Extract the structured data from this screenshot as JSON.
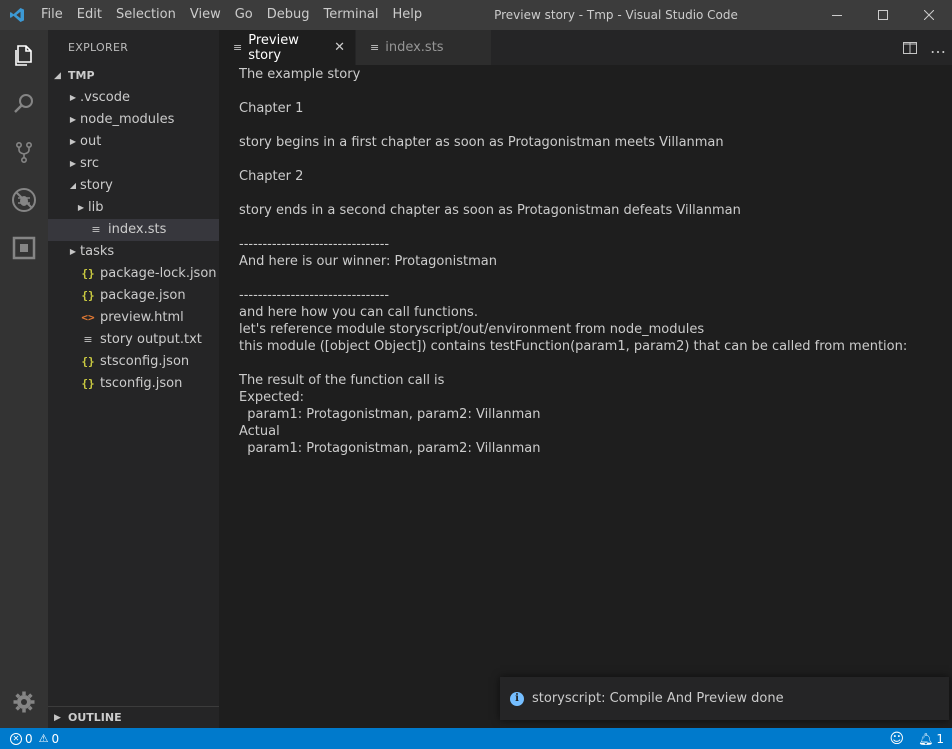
{
  "titlebar": {
    "menu": [
      "File",
      "Edit",
      "Selection",
      "View",
      "Go",
      "Debug",
      "Terminal",
      "Help"
    ],
    "window_title": "Preview story - Tmp - Visual Studio Code"
  },
  "sidebar": {
    "title": "EXPLORER",
    "folder_name": "TMP",
    "items": [
      {
        "label": ".vscode",
        "type": "folder",
        "indent": 1
      },
      {
        "label": "node_modules",
        "type": "folder",
        "indent": 1
      },
      {
        "label": "out",
        "type": "folder",
        "indent": 1
      },
      {
        "label": "src",
        "type": "folder",
        "indent": 1
      },
      {
        "label": "story",
        "type": "folder-open",
        "indent": 1
      },
      {
        "label": "lib",
        "type": "folder",
        "indent": 2
      },
      {
        "label": "index.sts",
        "type": "lines",
        "indent": 2,
        "selected": true
      },
      {
        "label": "tasks",
        "type": "folder",
        "indent": 1
      },
      {
        "label": "package-lock.json",
        "type": "json",
        "indent": 1
      },
      {
        "label": "package.json",
        "type": "json",
        "indent": 1
      },
      {
        "label": "preview.html",
        "type": "html",
        "indent": 1
      },
      {
        "label": "story output.txt",
        "type": "lines",
        "indent": 1
      },
      {
        "label": "stsconfig.json",
        "type": "json",
        "indent": 1
      },
      {
        "label": "tsconfig.json",
        "type": "json",
        "indent": 1
      }
    ],
    "outline_label": "OUTLINE"
  },
  "tabs": [
    {
      "label": "Preview story",
      "active": true
    },
    {
      "label": "index.sts",
      "active": false
    }
  ],
  "preview_lines": [
    "The example story",
    "",
    "Chapter 1",
    "",
    "story begins in a first chapter as soon as Protagonistman meets Villanman",
    "",
    "Chapter 2",
    "",
    "story ends in a second chapter as soon as Protagonistman defeats Villanman",
    "",
    "--------------------------------",
    "And here is our winner: Protagonistman",
    "",
    "--------------------------------",
    "and here how you can call functions.",
    "let's reference module storyscript/out/environment from node_modules",
    "this module ([object Object]) contains testFunction(param1, param2) that can be called from mention:",
    "",
    "The result of the function call is",
    "Expected:",
    "  param1: Protagonistman, param2: Villanman",
    "Actual",
    "  param1: Protagonistman, param2: Villanman"
  ],
  "notification": {
    "message": "storyscript: Compile And Preview done"
  },
  "statusbar": {
    "errors": "0",
    "warnings": "0",
    "notifications": "1"
  },
  "colors": {
    "accent": "#007acc",
    "titlebar": "#3c3c3c",
    "activitybar": "#333333",
    "sidebar": "#252526",
    "editor": "#1e1e1e"
  }
}
